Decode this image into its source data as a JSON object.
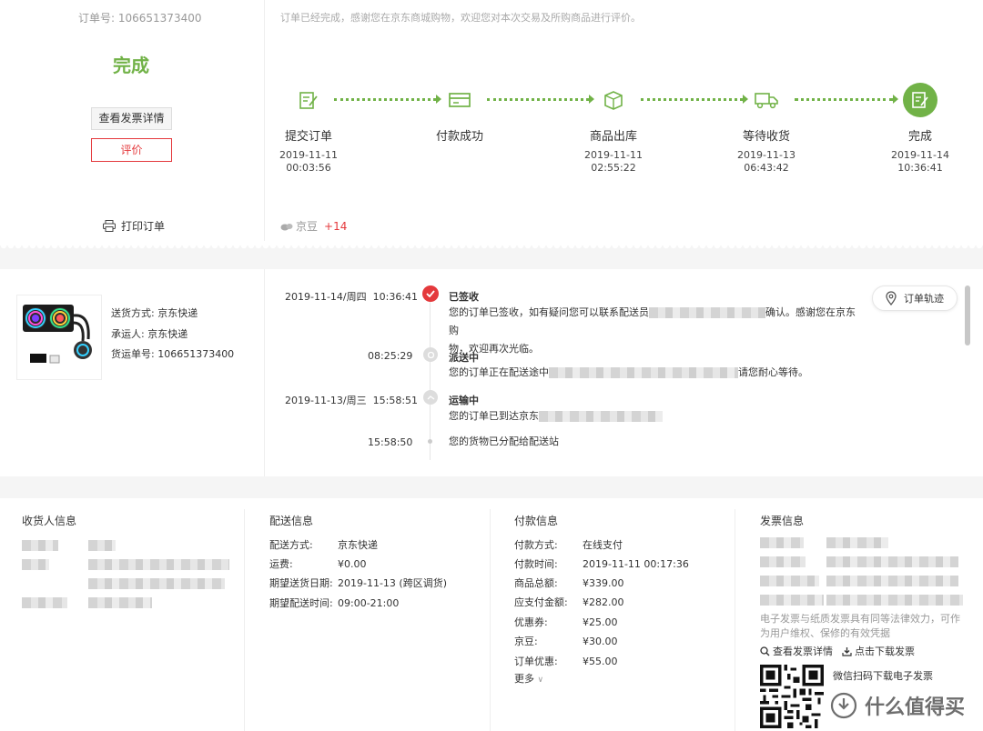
{
  "order": {
    "number_label": "订单号: ",
    "number": "106651373400",
    "status": "完成",
    "invoice_button": "查看发票详情",
    "review_button": "评价",
    "print_link": "打印订单",
    "thanks_text": "订单已经完成，感谢您在京东商城购物，欢迎您对本次交易及所购商品进行评价。"
  },
  "progress": {
    "steps": [
      {
        "label": "提交订单",
        "date": "2019-11-11",
        "time": "00:03:56",
        "icon": "edit-form-icon"
      },
      {
        "label": "付款成功",
        "date": "",
        "time": "",
        "icon": "card-icon"
      },
      {
        "label": "商品出库",
        "date": "2019-11-11",
        "time": "02:55:22",
        "icon": "box-icon"
      },
      {
        "label": "等待收货",
        "date": "2019-11-13",
        "time": "06:43:42",
        "icon": "truck-icon"
      },
      {
        "label": "完成",
        "date": "2019-11-14",
        "time": "10:36:41",
        "icon": "check-form-icon"
      }
    ],
    "beans_label": "京豆",
    "beans_plus": "+14",
    "accent": "#71b247"
  },
  "shipment": {
    "method_label": "送货方式: ",
    "method": "京东快递",
    "carrier_label": "承运人: ",
    "carrier": "京东快递",
    "tracking_label": "货运单号: ",
    "tracking": "106651373400",
    "track_button": "订单轨迹",
    "events": [
      {
        "date": "2019-11-14/周四",
        "time": "10:36:41",
        "title": "已签收",
        "text1": "您的订单已签收，如有疑问您可以联系配送员",
        "text1b": "确认。感谢您在京东购",
        "text2": "物，欢迎再次光临。"
      },
      {
        "date": "",
        "time": "08:25:29",
        "title": "派送中",
        "text1": "您的订单正在配送途中",
        "text1b": "请您耐心等待。"
      },
      {
        "date": "2019-11-13/周三",
        "time": "15:58:51",
        "title": "运输中",
        "text1": "您的订单已到达京东"
      },
      {
        "date": "",
        "time": "15:58:50",
        "title": "",
        "text1": "您的货物已分配给配送站"
      }
    ],
    "signed_color": "#e4393c"
  },
  "info": {
    "receiver_title": "收货人信息",
    "delivery_title": "配送信息",
    "delivery": [
      {
        "k": "配送方式:",
        "v": "京东快递"
      },
      {
        "k": "运费:",
        "v": "¥0.00"
      },
      {
        "k": "期望送货日期:",
        "v": "2019-11-13 (跨区调货)"
      },
      {
        "k": "期望配送时间:",
        "v": "09:00-21:00"
      }
    ],
    "payment_title": "付款信息",
    "payment": [
      {
        "k": "付款方式:",
        "v": "在线支付"
      },
      {
        "k": "付款时间:",
        "v": "2019-11-11 00:17:36"
      },
      {
        "k": "商品总额:",
        "v": "¥339.00"
      },
      {
        "k": "应支付金额:",
        "v": "¥282.00"
      },
      {
        "k": "优惠券:",
        "v": "¥25.00"
      },
      {
        "k": "京豆:",
        "v": "¥30.00"
      },
      {
        "k": "订单优惠:",
        "v": "¥55.00"
      }
    ],
    "more": "更多",
    "invoice_title": "发票信息",
    "invoice_note": "电子发票与纸质发票具有同等法律效力，可作为用户维权、保修的有效凭据",
    "invoice_detail_link": "查看发票详情",
    "invoice_download_link": "点击下载发票",
    "wechat_download": "微信扫码下载电子发票"
  },
  "watermark": "什么值得买"
}
